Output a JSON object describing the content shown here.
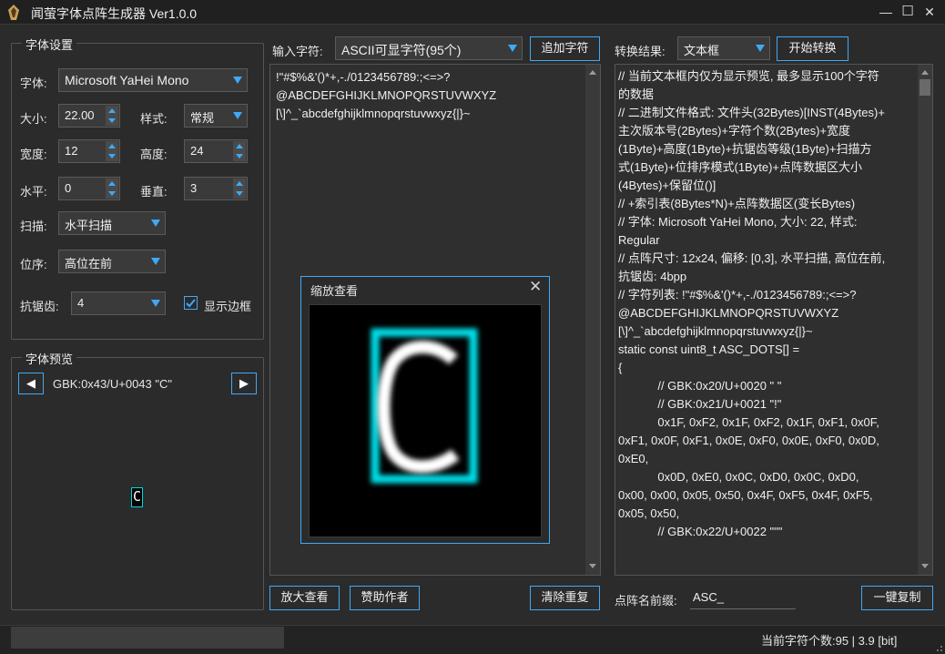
{
  "window": {
    "title": "闻萤字体点阵生成器 Ver1.0.0",
    "minimize": "—",
    "maximize": "☐",
    "close": "✕"
  },
  "font_settings": {
    "group_title": "字体设置",
    "font_label": "字体:",
    "font_value": "Microsoft YaHei Mono",
    "size_label": "大小:",
    "size_value": "22.00",
    "style_label": "样式:",
    "style_value": "常规",
    "width_label": "宽度:",
    "width_value": "12",
    "height_label": "高度:",
    "height_value": "24",
    "horiz_label": "水平:",
    "horiz_value": "0",
    "vert_label": "垂直:",
    "vert_value": "3",
    "scan_label": "扫描:",
    "scan_value": "水平扫描",
    "order_label": "位序:",
    "order_value": "高位在前",
    "aa_label": "抗锯齿:",
    "aa_value": "4",
    "border_label": "显示边框",
    "border_checked": true
  },
  "preview": {
    "group_title": "字体预览",
    "prev": "◀",
    "next": "▶",
    "char_info": "GBK:0x43/U+0043 \"C\"",
    "char": "C"
  },
  "input": {
    "label": "输入字符:",
    "source_value": "ASCII可显字符(95个)",
    "append_button": "追加字符",
    "text_lines": [
      "!\"#$%&'()*+,-./0123456789:;<=>?",
      "@ABCDEFGHIJKLMNOPQRSTUVWXYZ",
      "[\\]^_`abcdefghijklmnopqrstuvwxyz{|}~"
    ]
  },
  "zoom": {
    "title": "缩放查看",
    "close": "✕"
  },
  "output": {
    "label": "转换结果:",
    "mode_value": "文本框",
    "convert_button": "开始转换",
    "lines": [
      "// 当前文本框内仅为显示预览, 最多显示100个字符",
      "的数据",
      "// 二进制文件格式: 文件头(32Bytes)[INST(4Bytes)+",
      "主次版本号(2Bytes)+字符个数(2Bytes)+宽度",
      "(1Byte)+高度(1Byte)+抗锯齿等级(1Byte)+扫描方",
      "式(1Byte)+位排序模式(1Byte)+点阵数据区大小",
      "(4Bytes)+保留位()]",
      "// +索引表(8Bytes*N)+点阵数据区(变长Bytes)",
      "// 字体: Microsoft YaHei Mono, 大小: 22, 样式:",
      "Regular",
      "// 点阵尺寸: 12x24, 偏移: [0,3], 水平扫描, 高位在前,",
      "抗锯齿: 4bpp",
      "// 字符列表: !\"#$%&'()*+,-./0123456789:;<=>?",
      "@ABCDEFGHIJKLMNOPQRSTUVWXYZ",
      "[\\]^_`abcdefghijklmnopqrstuvwxyz{|}~",
      "static const uint8_t ASC_DOTS[] =",
      "{",
      "            // GBK:0x20/U+0020 \" \"",
      "",
      "            // GBK:0x21/U+0021 \"!\"",
      "            0x1F, 0xF2, 0x1F, 0xF2, 0x1F, 0xF1, 0x0F,",
      "0xF1, 0x0F, 0xF1, 0x0E, 0xF0, 0x0E, 0xF0, 0x0D,",
      "0xE0,",
      "            0x0D, 0xE0, 0x0C, 0xD0, 0x0C, 0xD0,",
      "0x00, 0x00, 0x05, 0x50, 0x4F, 0xF5, 0x4F, 0xF5,",
      "0x05, 0x50,",
      "",
      "            // GBK:0x22/U+0022 \"\"\""
    ]
  },
  "bottom": {
    "zoom_button": "放大查看",
    "sponsor_button": "赞助作者",
    "clear_button": "清除重复",
    "prefix_label": "点阵名前缀:",
    "prefix_value": "ASC_",
    "copy_button": "一键复制"
  },
  "status": {
    "text": "当前字符个数:95 | 3.9 [bit]"
  },
  "colors": {
    "accent": "#3fa9f5",
    "glyph_border": "#00d8e0",
    "background": "#2b2b2b"
  }
}
